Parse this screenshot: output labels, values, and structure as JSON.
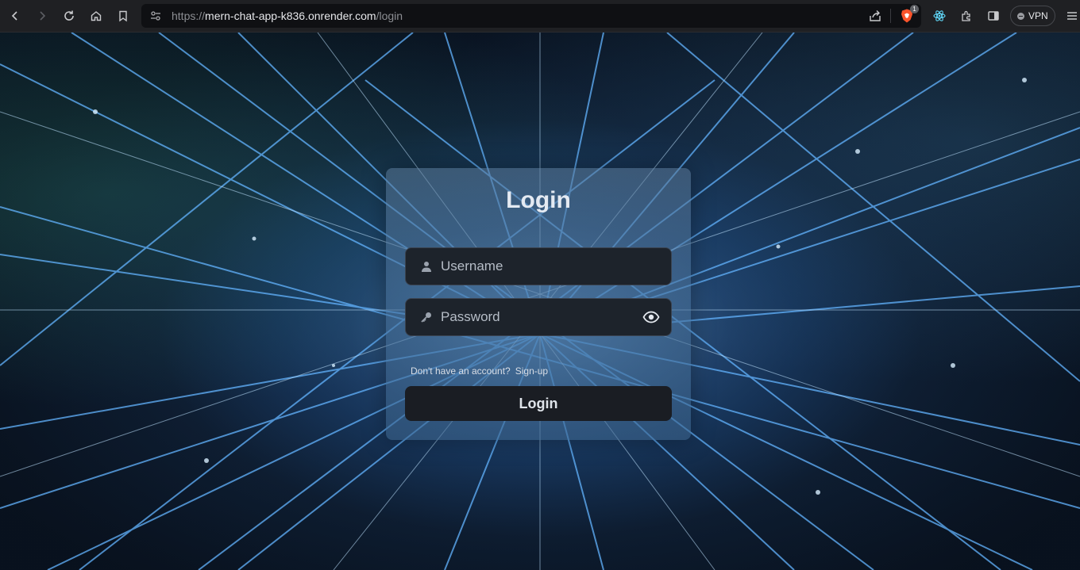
{
  "browser": {
    "url_scheme": "https://",
    "url_host": "mern-chat-app-k836.onrender.com",
    "url_path": "/login",
    "brave_badge": "1",
    "vpn_label": "VPN",
    "icons": [
      "back-icon",
      "forward-icon",
      "reload-icon",
      "home-icon",
      "bookmark-icon",
      "site-info-icon",
      "share-icon",
      "brave-shield-icon",
      "react-devtools-icon",
      "extensions-icon",
      "sidebar-icon",
      "menu-icon"
    ]
  },
  "login": {
    "title": "Login",
    "username_placeholder": "Username",
    "password_placeholder": "Password",
    "signup_prompt": "Don't have an account?",
    "signup_link": "Sign-up",
    "submit_label": "Login"
  },
  "colors": {
    "browser_bar": "#1f2023",
    "card_tint": "#4a7090",
    "input_bg": "#1d232b",
    "button_bg": "#1a1d23",
    "network_lines": "#5aa8ff"
  }
}
